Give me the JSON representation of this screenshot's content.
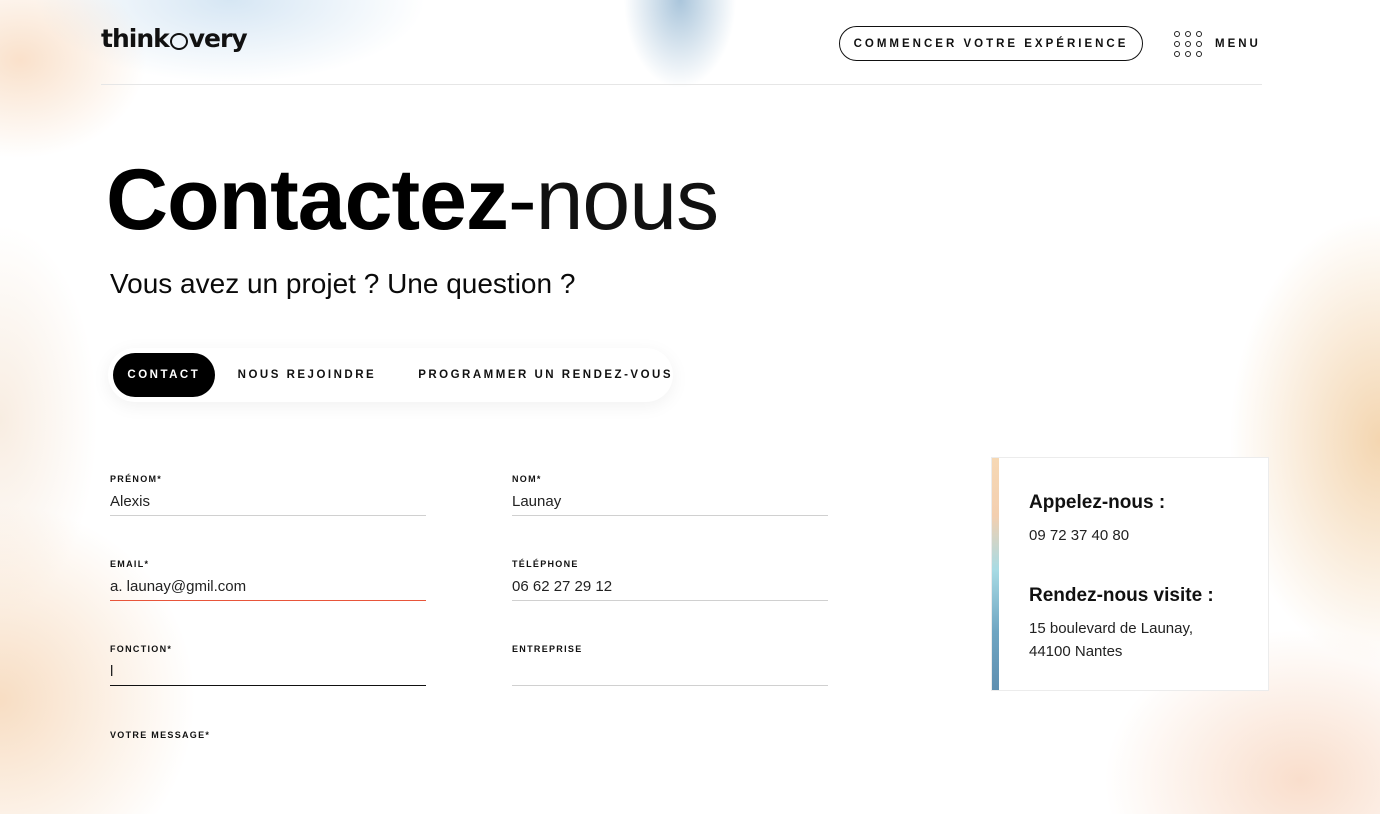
{
  "header": {
    "logo_prefix": "think",
    "logo_suffix": "very",
    "cta_label": "COMMENCER VOTRE EXPÉRIENCE",
    "menu_label": "MENU"
  },
  "hero": {
    "title_bold": "Contactez",
    "title_dash": "-",
    "title_light": "nous",
    "subtitle": "Vous avez un projet ? Une question ?"
  },
  "tabs": [
    {
      "label": "CONTACT",
      "active": true
    },
    {
      "label": "NOUS REJOINDRE",
      "active": false
    },
    {
      "label": "PROGRAMMER UN RENDEZ-VOUS",
      "active": false
    }
  ],
  "form": {
    "prenom": {
      "label": "PRÉNOM*",
      "value": "Alexis"
    },
    "nom": {
      "label": "NOM*",
      "value": "Launay"
    },
    "email": {
      "label": "EMAIL*",
      "value": "a. launay@gmil.com"
    },
    "telephone": {
      "label": "TÉLÉPHONE",
      "value": "06 62 27 29 12"
    },
    "fonction": {
      "label": "FONCTION*",
      "value": "l"
    },
    "entreprise": {
      "label": "ENTREPRISE",
      "value": ""
    },
    "message": {
      "label": "VOTRE MESSAGE*"
    }
  },
  "contact_card": {
    "call_title": "Appelez-nous :",
    "phone": "09 72 37 40 80",
    "visit_title": "Rendez-nous visite :",
    "address_line1": "15 boulevard de Launay,",
    "address_line2": "44100 Nantes"
  },
  "colors": {
    "primary": "#000000",
    "error_underline": "#e8553a",
    "accent_peach": "#f3cfb0",
    "accent_blue": "#6fa5c2"
  }
}
